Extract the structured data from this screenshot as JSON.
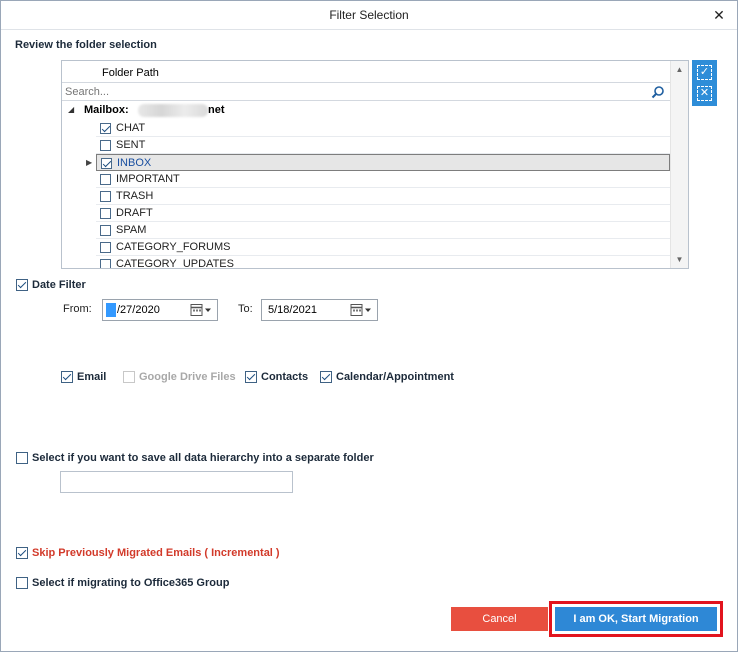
{
  "window": {
    "title": "Filter Selection",
    "close_glyph": "✕"
  },
  "folder_section": {
    "label": "Review the folder selection",
    "column_header": "Folder Path",
    "search_placeholder": "Search...",
    "mailbox_label": "Mailbox:",
    "mailbox_suffix": "net",
    "folders": [
      {
        "name": "CHAT",
        "checked": true
      },
      {
        "name": "SENT",
        "checked": false
      },
      {
        "name": "INBOX",
        "checked": true,
        "selected": true,
        "expandable": true
      },
      {
        "name": "IMPORTANT",
        "checked": false
      },
      {
        "name": "TRASH",
        "checked": false
      },
      {
        "name": "DRAFT",
        "checked": false
      },
      {
        "name": "SPAM",
        "checked": false
      },
      {
        "name": "CATEGORY_FORUMS",
        "checked": false
      },
      {
        "name": "CATEGORY_UPDATES",
        "checked": false
      }
    ]
  },
  "date_filter": {
    "label": "Date Filter",
    "checked": true,
    "from_label": "From:",
    "from_value": "4/27/2020",
    "from_display": "/27/2020",
    "to_label": "To:",
    "to_value": "5/18/2021"
  },
  "item_types": [
    {
      "label": "Email",
      "checked": true,
      "enabled": true
    },
    {
      "label": "Google Drive Files",
      "checked": false,
      "enabled": false
    },
    {
      "label": "Contacts",
      "checked": true,
      "enabled": true
    },
    {
      "label": "Calendar/Appointment",
      "checked": true,
      "enabled": true
    }
  ],
  "hierarchy": {
    "label": "Select if you want to save all data hierarchy into a separate folder",
    "checked": false,
    "folder_name_value": ""
  },
  "skip_migrated": {
    "label": "Skip Previously Migrated Emails ( Incremental )",
    "checked": true
  },
  "office365_group": {
    "label": "Select if migrating to Office365 Group",
    "checked": false
  },
  "buttons": {
    "cancel": "Cancel",
    "start": "I am OK, Start Migration"
  },
  "colors": {
    "accent": "#2e88d6",
    "cancel": "#e84f3f",
    "highlight_frame": "#e2141e",
    "warning_text": "#d23a2a"
  }
}
